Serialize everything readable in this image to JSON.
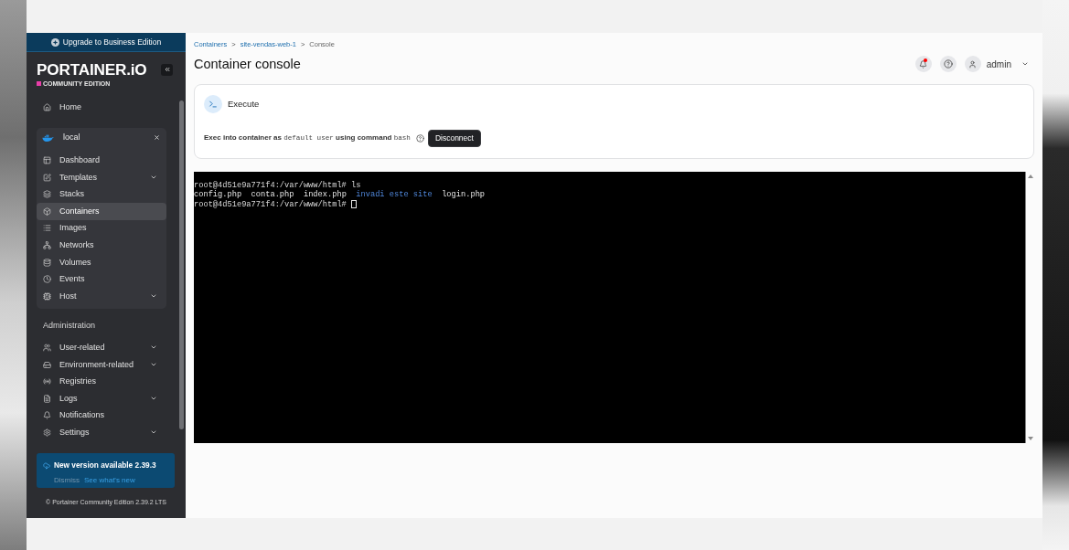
{
  "upgrade_banner": {
    "label": "Upgrade to Business Edition"
  },
  "brand": {
    "logo": "PORTAINER.iO",
    "edition": "COMMUNITY EDITION"
  },
  "sidebar": {
    "items": [
      {
        "label": "Home",
        "selected": false,
        "has_submenu": false
      }
    ],
    "environment": {
      "name": "local",
      "items": [
        {
          "label": "Dashboard",
          "selected": false,
          "has_submenu": false
        },
        {
          "label": "Templates",
          "selected": false,
          "has_submenu": true
        },
        {
          "label": "Stacks",
          "selected": false,
          "has_submenu": false
        },
        {
          "label": "Containers",
          "selected": true,
          "has_submenu": false
        },
        {
          "label": "Images",
          "selected": false,
          "has_submenu": false
        },
        {
          "label": "Networks",
          "selected": false,
          "has_submenu": false
        },
        {
          "label": "Volumes",
          "selected": false,
          "has_submenu": false
        },
        {
          "label": "Events",
          "selected": false,
          "has_submenu": false
        },
        {
          "label": "Host",
          "selected": false,
          "has_submenu": true
        }
      ]
    },
    "sections": [
      {
        "title": "Administration",
        "items": [
          {
            "label": "User-related",
            "selected": false,
            "has_submenu": true
          },
          {
            "label": "Environment-related",
            "selected": false,
            "has_submenu": true
          },
          {
            "label": "Registries",
            "selected": false,
            "has_submenu": false
          },
          {
            "label": "Logs",
            "selected": false,
            "has_submenu": true
          },
          {
            "label": "Notifications",
            "selected": false,
            "has_submenu": false
          },
          {
            "label": "Settings",
            "selected": false,
            "has_submenu": true
          }
        ]
      }
    ]
  },
  "update_notice": {
    "title": "New version available 2.39.3",
    "dismiss": "Dismiss",
    "link": "See what's new"
  },
  "footer": "© Portainer Community Edition 2.39.2 LTS",
  "breadcrumbs": [
    {
      "label": "Containers",
      "kind": "link"
    },
    {
      "label": ">",
      "kind": "separator"
    },
    {
      "label": "site-vendas-web-1",
      "kind": "link"
    },
    {
      "label": ">",
      "kind": "separator"
    },
    {
      "label": "Console",
      "kind": "current"
    }
  ],
  "page_title": "Container console",
  "header": {
    "notifications": {
      "unread": true
    },
    "user": {
      "name": "admin"
    }
  },
  "execute_card": {
    "title": "Execute",
    "description": [
      {
        "text": "Exec into container as",
        "kind": "text"
      },
      {
        "text": "default user",
        "kind": "code"
      },
      {
        "text": "using command",
        "kind": "text"
      },
      {
        "text": "bash",
        "kind": "code"
      }
    ],
    "button": "Disconnect"
  },
  "terminal": {
    "lines": [
      {
        "kind": "command",
        "text": "root@4d51e9a771f4:/var/www/html# ls",
        "cursor": false
      },
      {
        "kind": "listing",
        "entries": [
          {
            "text": "config.php",
            "kind": "file"
          },
          {
            "text": "conta.php",
            "kind": "file"
          },
          {
            "text": "index.php",
            "kind": "file"
          },
          {
            "text": "invadi este site",
            "kind": "directory"
          },
          {
            "text": "login.php",
            "kind": "file"
          }
        ]
      },
      {
        "kind": "command",
        "text": "root@4d51e9a771f4:/var/www/html#",
        "cursor": true
      }
    ]
  }
}
